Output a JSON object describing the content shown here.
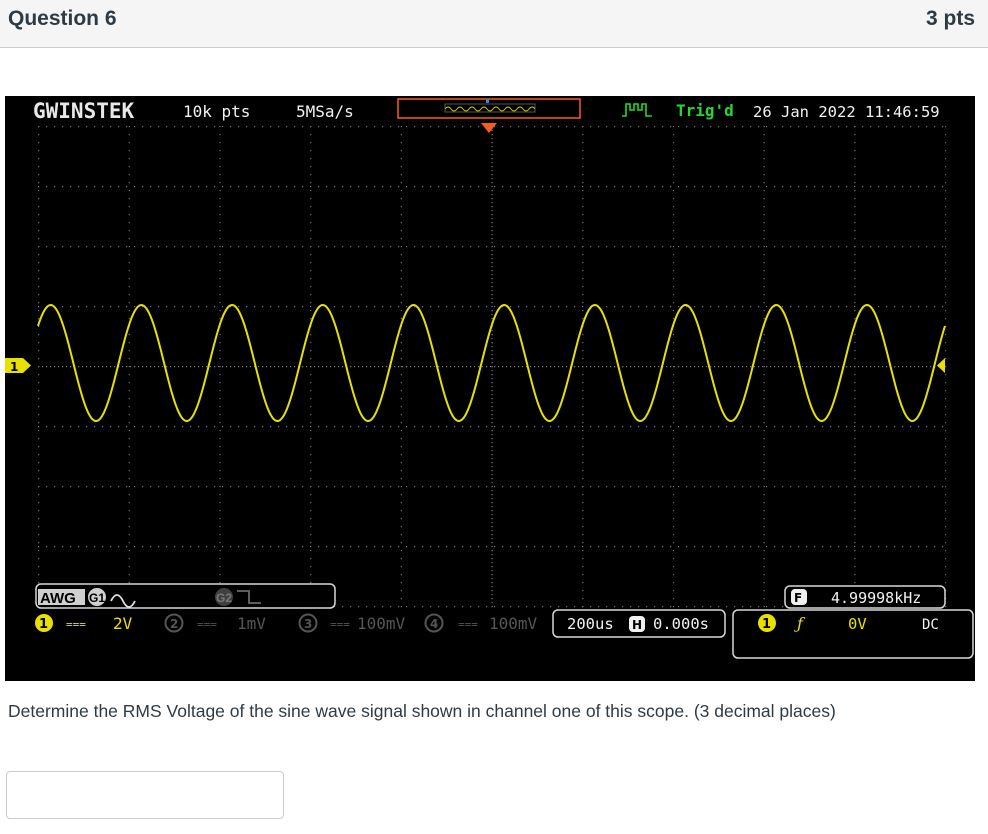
{
  "question": {
    "title": "Question 6",
    "points": "3 pts",
    "text": "Determine the RMS Voltage of the sine wave signal shown in channel one of this scope. (3 decimal places)"
  },
  "answer": {
    "value": "",
    "placeholder": ""
  },
  "scope": {
    "brand": "GWINSTEK",
    "record_length": "10k pts",
    "sample_rate": "5MSa/s",
    "trigger_state": "Trig'd",
    "datetime": "26 Jan 2022 11:46:59",
    "ch1_marker": "1",
    "awg_label": "AWG",
    "g1_label": "G1",
    "g2_label": "G2",
    "channels": [
      {
        "num": "1",
        "coupling": "===",
        "scale": "2V"
      },
      {
        "num": "2",
        "coupling": "===",
        "scale": "1mV"
      },
      {
        "num": "3",
        "coupling": "===",
        "scale": "100mV"
      },
      {
        "num": "4",
        "coupling": "===",
        "scale": "100mV"
      }
    ],
    "timebase": "200us",
    "h_label": "H",
    "h_position": "0.000s",
    "freq_label": "F",
    "frequency": "4.99998kHz",
    "trigger_source": "1",
    "trigger_slope": "ƒ",
    "trigger_level": "0V",
    "trigger_coupling": "DC",
    "colors": {
      "ch1": "#e8e000",
      "ch2": "#555555",
      "trigger": "#ff5a1e",
      "trig_ok": "#27d827",
      "grid": "#777777"
    }
  }
}
